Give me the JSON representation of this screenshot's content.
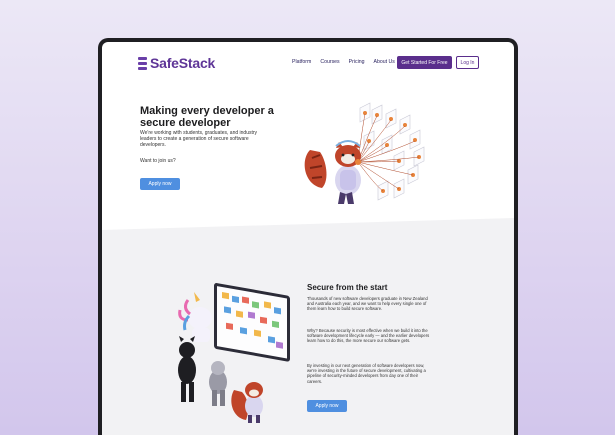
{
  "nav": {
    "logo_text": "SafeStack",
    "links": [
      "Platform",
      "Courses",
      "Pricing",
      "About Us"
    ],
    "cta_label": "Get Started For Free",
    "login_label": "Log In"
  },
  "hero": {
    "title": "Making every developer a secure developer",
    "text": "We're working with students, graduates, and industry leaders to create a generation of secure software developers.",
    "join_text": "Want to join us?",
    "apply_label": "Apply now"
  },
  "section2": {
    "title": "Secure from the start",
    "paragraphs": [
      "Thousands of new software developers graduate in New Zealand and Australia each year, and we want to help every single one of them learn how to build secure software.",
      "Why? Because security is most effective when we build it into the software development lifecycle early — and the earlier developers learn how to do this, the more secure our software gets.",
      "By investing in our next generation of software developers now, we're investing in the future of secure development, cultivating a pipeline of security-minded developers from day one of their careers."
    ],
    "apply_label": "Apply now"
  },
  "colors": {
    "brand": "#5a2e8c",
    "accent_button": "#4f8fe0",
    "background": "#ddd3f0"
  }
}
